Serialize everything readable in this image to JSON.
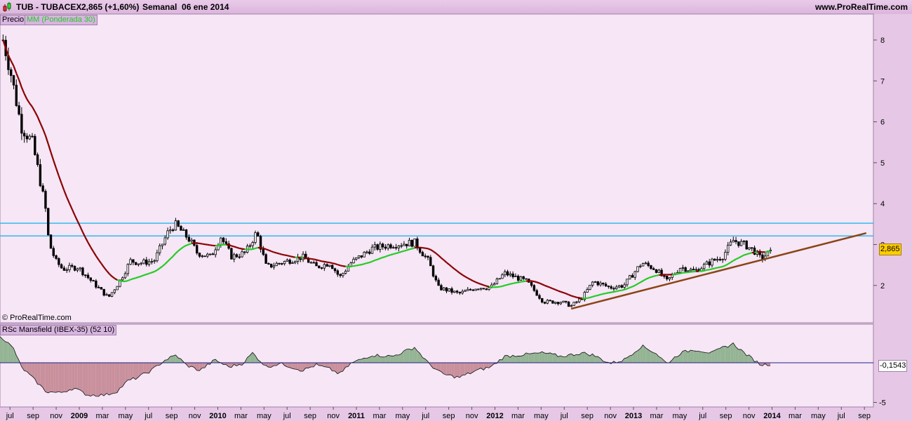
{
  "header": {
    "symbol": "TUB - TUBACEX",
    "quote": "2,865 (+1,60%)",
    "period": "Semanal  06 ene 2014",
    "site": "www.ProRealTime.com",
    "icon": "candlestick-icon"
  },
  "price_panel": {
    "legend_price": "Precio",
    "legend_ma": "MM (Ponderada 30)",
    "copyright": "© ProRealTime.com",
    "last_value_label": "2,865"
  },
  "rsc_panel": {
    "legend": "RSc Mansfield (IBEX-35) (52 10)",
    "last_value_label": "-0,1543"
  },
  "colors": {
    "background": "#f6e6f6",
    "ma_up": "#22cc22",
    "ma_down": "#8b0000",
    "hline": "#33bbee",
    "trendline": "#8b4513",
    "rsc_pos": "#94b494",
    "rsc_neg": "#c8909c",
    "last_price_bg": "#ffcc00"
  },
  "chart_data": [
    {
      "type": "candlestick",
      "title": "TUB - TUBACEX Semanal",
      "ylim": [
        1.05,
        8.6
      ],
      "yticks": [
        2,
        3,
        4,
        5,
        6,
        7,
        8
      ],
      "xlabels": [
        "jul",
        "sep",
        "nov",
        "2009",
        "mar",
        "may",
        "jul",
        "sep",
        "nov",
        "2010",
        "mar",
        "may",
        "jul",
        "sep",
        "nov",
        "2011",
        "mar",
        "may",
        "jul",
        "sep",
        "nov",
        "2012",
        "mar",
        "may",
        "jul",
        "sep",
        "nov",
        "2013",
        "mar",
        "may",
        "jul",
        "sep",
        "nov",
        "2014",
        "mar",
        "may",
        "jul",
        "sep"
      ],
      "close_keypoints": [
        [
          2008.45,
          8.0
        ],
        [
          2008.5,
          7.3
        ],
        [
          2008.58,
          5.9
        ],
        [
          2008.66,
          5.5
        ],
        [
          2008.71,
          4.7
        ],
        [
          2008.76,
          3.8
        ],
        [
          2008.78,
          3.05
        ],
        [
          2008.83,
          2.6
        ],
        [
          2008.88,
          2.4
        ],
        [
          2008.99,
          2.45
        ],
        [
          2009.09,
          2.1
        ],
        [
          2009.21,
          1.7
        ],
        [
          2009.29,
          2.1
        ],
        [
          2009.37,
          2.6
        ],
        [
          2009.44,
          2.55
        ],
        [
          2009.54,
          2.6
        ],
        [
          2009.64,
          3.3
        ],
        [
          2009.69,
          3.5
        ],
        [
          2009.8,
          3.1
        ],
        [
          2009.85,
          2.8
        ],
        [
          2009.95,
          2.7
        ],
        [
          2010.02,
          3.2
        ],
        [
          2010.1,
          2.7
        ],
        [
          2010.2,
          2.8
        ],
        [
          2010.28,
          3.3
        ],
        [
          2010.35,
          2.45
        ],
        [
          2010.45,
          2.55
        ],
        [
          2010.61,
          2.7
        ],
        [
          2010.71,
          2.45
        ],
        [
          2010.81,
          2.55
        ],
        [
          2010.88,
          2.2
        ],
        [
          2010.96,
          2.55
        ],
        [
          2011.11,
          2.9
        ],
        [
          2011.26,
          3.0
        ],
        [
          2011.42,
          3.05
        ],
        [
          2011.52,
          2.6
        ],
        [
          2011.59,
          1.95
        ],
        [
          2011.74,
          1.8
        ],
        [
          2011.87,
          1.95
        ],
        [
          2011.97,
          1.95
        ],
        [
          2012.07,
          2.3
        ],
        [
          2012.23,
          2.1
        ],
        [
          2012.35,
          1.6
        ],
        [
          2012.48,
          1.6
        ],
        [
          2012.55,
          1.5
        ],
        [
          2012.63,
          1.7
        ],
        [
          2012.71,
          2.1
        ],
        [
          2012.83,
          1.95
        ],
        [
          2012.93,
          2.0
        ],
        [
          2013.06,
          2.55
        ],
        [
          2013.16,
          2.4
        ],
        [
          2013.24,
          2.1
        ],
        [
          2013.34,
          2.45
        ],
        [
          2013.44,
          2.35
        ],
        [
          2013.57,
          2.6
        ],
        [
          2013.64,
          2.7
        ],
        [
          2013.72,
          3.1
        ],
        [
          2013.8,
          3.0
        ],
        [
          2013.87,
          2.85
        ],
        [
          2013.92,
          2.65
        ],
        [
          2014.0,
          2.865
        ]
      ],
      "ma_period": 30,
      "horizontal_lines": [
        3.52,
        3.21
      ],
      "trendline": [
        [
          2012.55,
          1.43
        ],
        [
          2014.68,
          3.28
        ]
      ],
      "last_value": 2.865
    },
    {
      "type": "area",
      "title": "RSc Mansfield (IBEX-35) (52 10)",
      "ylim": [
        -5.5,
        5.0
      ],
      "yticks": [
        -5
      ],
      "baseline": 0,
      "keypoints": [
        [
          2008.43,
          3.45
        ],
        [
          2008.48,
          2.57
        ],
        [
          2008.53,
          1.68
        ],
        [
          2008.58,
          -0.53
        ],
        [
          2008.66,
          -1.86
        ],
        [
          2008.76,
          -3.63
        ],
        [
          2008.86,
          -3.8
        ],
        [
          2008.96,
          -3.19
        ],
        [
          2009.06,
          -4.07
        ],
        [
          2009.19,
          -4.07
        ],
        [
          2009.27,
          -3.63
        ],
        [
          2009.35,
          -2.3
        ],
        [
          2009.42,
          -1.86
        ],
        [
          2009.52,
          -0.97
        ],
        [
          2009.62,
          0.35
        ],
        [
          2009.7,
          0.97
        ],
        [
          2009.77,
          -0.27
        ],
        [
          2009.87,
          -0.97
        ],
        [
          2009.98,
          0.35
        ],
        [
          2010.08,
          -0.53
        ],
        [
          2010.18,
          -0.09
        ],
        [
          2010.25,
          1.24
        ],
        [
          2010.35,
          -0.53
        ],
        [
          2010.45,
          -0.09
        ],
        [
          2010.61,
          -0.97
        ],
        [
          2010.71,
          -0.27
        ],
        [
          2010.81,
          -0.8
        ],
        [
          2010.88,
          -1.42
        ],
        [
          2010.96,
          -0.09
        ],
        [
          2011.11,
          0.97
        ],
        [
          2011.26,
          0.8
        ],
        [
          2011.42,
          1.95
        ],
        [
          2011.52,
          -0.09
        ],
        [
          2011.62,
          -1.42
        ],
        [
          2011.74,
          -1.86
        ],
        [
          2011.87,
          -0.97
        ],
        [
          2011.97,
          -0.53
        ],
        [
          2012.07,
          0.8
        ],
        [
          2012.23,
          1.06
        ],
        [
          2012.35,
          1.24
        ],
        [
          2012.48,
          0.8
        ],
        [
          2012.63,
          1.24
        ],
        [
          2012.71,
          0.97
        ],
        [
          2012.83,
          -0.09
        ],
        [
          2012.93,
          0.35
        ],
        [
          2013.06,
          2.12
        ],
        [
          2013.16,
          1.24
        ],
        [
          2013.24,
          -0.09
        ],
        [
          2013.34,
          1.24
        ],
        [
          2013.44,
          1.68
        ],
        [
          2013.57,
          1.24
        ],
        [
          2013.64,
          1.86
        ],
        [
          2013.72,
          2.39
        ],
        [
          2013.8,
          1.24
        ],
        [
          2013.87,
          0.35
        ],
        [
          2013.92,
          -0.27
        ],
        [
          2014.0,
          -0.15
        ]
      ],
      "last_value": -0.1543
    }
  ]
}
